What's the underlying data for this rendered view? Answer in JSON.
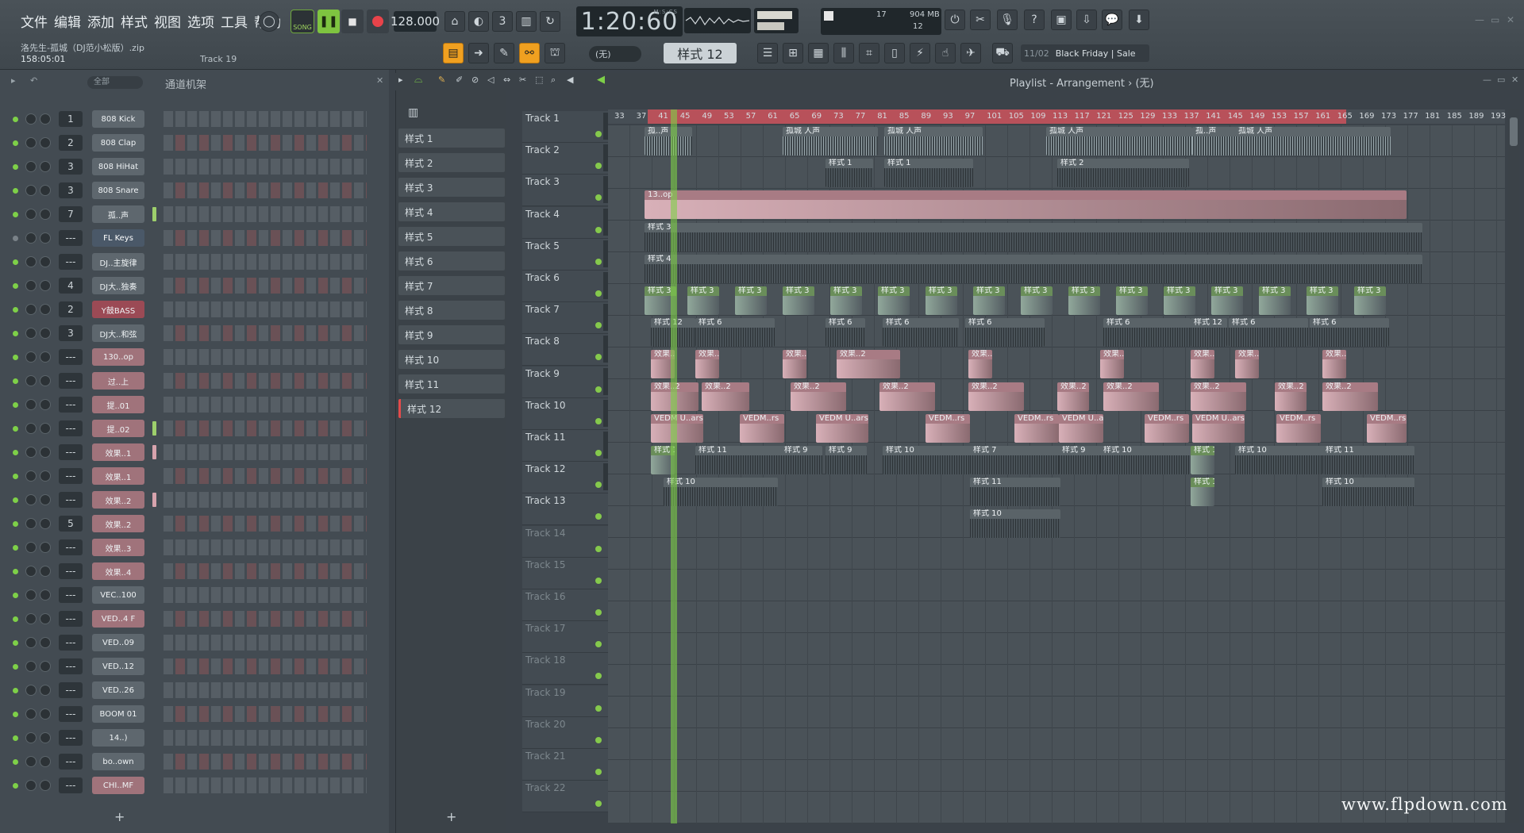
{
  "menu": [
    "文件",
    "编辑",
    "添加",
    "样式",
    "视图",
    "选项",
    "工具",
    "帮助"
  ],
  "project": {
    "name": "洛先生-孤城（DJ范小松版）.zip",
    "time": "158:05:01",
    "track": "Track 19"
  },
  "transport": {
    "song": "SONG",
    "tempo": "128.000",
    "time": "1:20:60",
    "time_unit": "M:S:CS"
  },
  "cpu": {
    "a": "17",
    "b": "904 MB",
    "c": "12"
  },
  "pattern": {
    "current": "样式 12",
    "none": "(无)"
  },
  "news": {
    "date": "11/02",
    "text": "Black Friday | Sale"
  },
  "rack": {
    "filter": "全部",
    "title": "通道机架",
    "channels": [
      {
        "num": "1",
        "name": "808 Kick",
        "style": "",
        "bar": ""
      },
      {
        "num": "2",
        "name": "808 Clap",
        "style": "",
        "bar": ""
      },
      {
        "num": "3",
        "name": "808 HiHat",
        "style": "",
        "bar": ""
      },
      {
        "num": "3",
        "name": "808 Snare",
        "style": "",
        "bar": ""
      },
      {
        "num": "7",
        "name": "孤..声",
        "style": "",
        "bar": "g"
      },
      {
        "num": "---",
        "name": "FL Keys",
        "style": "sel",
        "bar": ""
      },
      {
        "num": "---",
        "name": "DJ..主旋律",
        "style": "",
        "bar": ""
      },
      {
        "num": "4",
        "name": "DJ大..独奏",
        "style": "",
        "bar": ""
      },
      {
        "num": "2",
        "name": "Y鼓BASS",
        "style": "red",
        "bar": ""
      },
      {
        "num": "3",
        "name": "DJ大..和弦",
        "style": "",
        "bar": ""
      },
      {
        "num": "---",
        "name": "130..op",
        "style": "pink",
        "bar": ""
      },
      {
        "num": "---",
        "name": "过..上",
        "style": "pink",
        "bar": ""
      },
      {
        "num": "---",
        "name": "提..01",
        "style": "pink",
        "bar": ""
      },
      {
        "num": "---",
        "name": "提..02",
        "style": "pink",
        "bar": "g"
      },
      {
        "num": "---",
        "name": "效果..1",
        "style": "pink",
        "bar": "p"
      },
      {
        "num": "---",
        "name": "效果..1",
        "style": "pink",
        "bar": ""
      },
      {
        "num": "---",
        "name": "效果..2",
        "style": "pink",
        "bar": "p"
      },
      {
        "num": "5",
        "name": "效果..2",
        "style": "pink",
        "bar": ""
      },
      {
        "num": "---",
        "name": "效果..3",
        "style": "pink",
        "bar": ""
      },
      {
        "num": "---",
        "name": "效果..4",
        "style": "pink",
        "bar": ""
      },
      {
        "num": "---",
        "name": "VEC..100",
        "style": "",
        "bar": ""
      },
      {
        "num": "---",
        "name": "VED..4 F",
        "style": "pink",
        "bar": ""
      },
      {
        "num": "---",
        "name": "VED..09",
        "style": "",
        "bar": ""
      },
      {
        "num": "---",
        "name": "VED..12",
        "style": "",
        "bar": ""
      },
      {
        "num": "---",
        "name": "VED..26",
        "style": "",
        "bar": ""
      },
      {
        "num": "---",
        "name": "BOOM 01",
        "style": "",
        "bar": ""
      },
      {
        "num": "---",
        "name": "14..)",
        "style": "",
        "bar": ""
      },
      {
        "num": "---",
        "name": "bo..own",
        "style": "",
        "bar": ""
      },
      {
        "num": "---",
        "name": "CHI..MF",
        "style": "pink",
        "bar": ""
      }
    ]
  },
  "patterns": [
    "样式 1",
    "样式 2",
    "样式 3",
    "样式 4",
    "样式 5",
    "样式 6",
    "样式 7",
    "样式 8",
    "样式 9",
    "样式 10",
    "样式 11",
    "样式 12"
  ],
  "playlist": {
    "title": "Playlist - Arrangement",
    "sub": "(无)",
    "ruler": [
      "33",
      "37",
      "41",
      "45",
      "49",
      "53",
      "57",
      "61",
      "65",
      "69",
      "73",
      "77",
      "81",
      "85",
      "89",
      "93",
      "97",
      "101",
      "105",
      "109",
      "113",
      "117",
      "121",
      "125",
      "129",
      "133",
      "137",
      "141",
      "145",
      "149",
      "153",
      "157",
      "161",
      "165",
      "169",
      "173",
      "177",
      "181",
      "185",
      "189",
      "193"
    ],
    "tracks": [
      "Track 1",
      "Track 2",
      "Track 3",
      "Track 4",
      "Track 5",
      "Track 6",
      "Track 7",
      "Track 8",
      "Track 9",
      "Track 10",
      "Track 11",
      "Track 12",
      "Track 13",
      "Track 14",
      "Track 15",
      "Track 16",
      "Track 17",
      "Track 18",
      "Track 19",
      "Track 20",
      "Track 21",
      "Track 22"
    ],
    "clip_labels": {
      "a": "孤..声",
      "b": "孤城 人声",
      "c": "样式 1",
      "d": "样式 2",
      "e": "13..op",
      "f": "样式 3",
      "g": "样式 4",
      "h": "样式 12",
      "i": "样式 6",
      "j": "效果..2",
      "k": "VEDM U..ars",
      "l": "VEDM..rs",
      "m": "样式 11",
      "n": "样式 9",
      "o": "样式 10",
      "p": "样式 7"
    }
  },
  "watermark": "www.flpdown.com"
}
